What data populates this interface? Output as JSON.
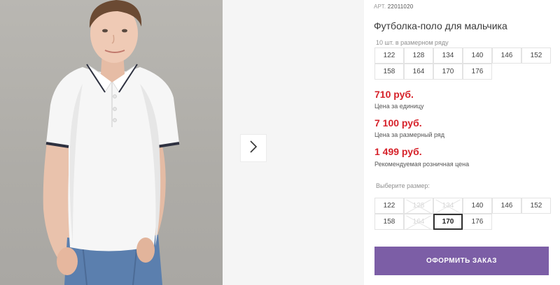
{
  "product": {
    "sku_label": "АРТ.",
    "sku": "22011020",
    "title": "Футболка-поло для мальчика",
    "row_note": "10 шт. в размерном ряду"
  },
  "pack_sizes": [
    "122",
    "128",
    "134",
    "140",
    "146",
    "152",
    "158",
    "164",
    "170",
    "176"
  ],
  "prices": [
    {
      "value": "710 руб.",
      "label": "Цена за единицу"
    },
    {
      "value": "7 100 руб.",
      "label": "Цена за размерный ряд"
    },
    {
      "value": "1 499 руб.",
      "label": "Рекомендуемая розничная цена"
    }
  ],
  "size_picker": {
    "label": "Выберите размер:",
    "options": [
      {
        "value": "122",
        "available": true
      },
      {
        "value": "128",
        "available": false
      },
      {
        "value": "134",
        "available": false
      },
      {
        "value": "140",
        "available": true
      },
      {
        "value": "146",
        "available": true
      },
      {
        "value": "152",
        "available": true
      },
      {
        "value": "158",
        "available": true
      },
      {
        "value": "164",
        "available": false
      },
      {
        "value": "170",
        "available": true
      },
      {
        "value": "176",
        "available": true
      }
    ],
    "selected": "170"
  },
  "order_button": "ОФОРМИТЬ ЗАКАЗ",
  "icons": {
    "gallery_next": "chevron-right-icon"
  },
  "colors": {
    "price": "#d6222a",
    "accent": "#7c5ea6"
  }
}
